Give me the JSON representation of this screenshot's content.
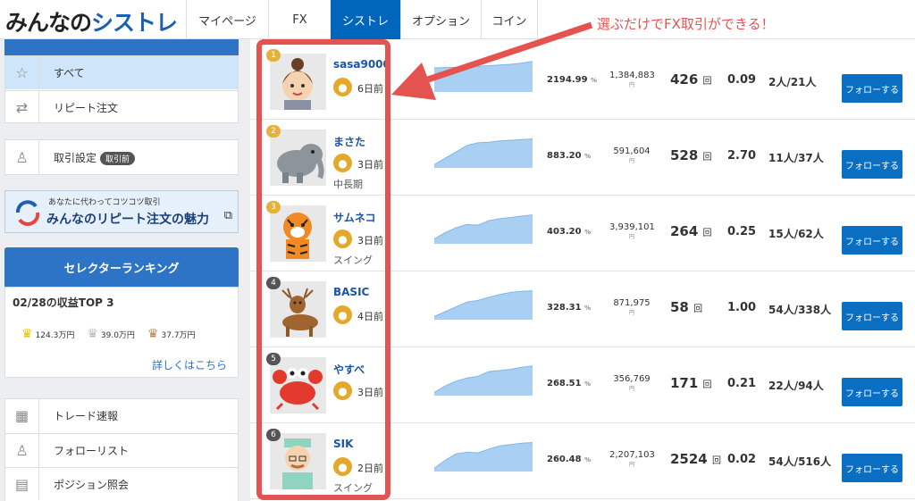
{
  "logo": {
    "part1": "みんなの",
    "part2": "シストレ"
  },
  "nav": {
    "tabs": [
      "マイページ",
      "FX",
      "シストレ",
      "オプション",
      "コイン"
    ]
  },
  "sidebar": {
    "menu1": [
      {
        "icon": "star-icon",
        "label": "すべて"
      },
      {
        "icon": "repeat-icon",
        "label": "リピート注文"
      }
    ],
    "settings": {
      "label": "取引設定",
      "badge": "取引前"
    },
    "banner": {
      "line1": "あなたに代わってコツコツ取引",
      "line2": "みんなのリピート注文の魅力"
    },
    "ranking": {
      "header": "セレクターランキング",
      "subtitle": "02/28の収益TOP 3",
      "crowns": [
        {
          "color": "#e8c100",
          "amount": "124.3万円"
        },
        {
          "color": "#b9b9b9",
          "amount": "39.0万円"
        },
        {
          "color": "#b7874a",
          "amount": "37.7万円"
        }
      ],
      "more": "詳しくはこちら"
    },
    "menu2": [
      {
        "icon": "grid-icon",
        "label": "トレード速報"
      },
      {
        "icon": "person-icon",
        "label": "フォローリスト"
      },
      {
        "icon": "book-icon",
        "label": "ポジション照会"
      }
    ]
  },
  "rows": [
    {
      "rank": "1",
      "rank_color": "#e3b23c",
      "name": "sasa9000",
      "days": "6日前",
      "style": "",
      "trend": [
        0.75,
        0.76,
        0.77,
        0.78,
        0.8,
        0.82,
        0.84,
        0.86,
        0.9,
        0.95
      ],
      "pct": "2194.99",
      "pct_unit": "%",
      "amount": "1,384,883",
      "amount_unit": "円",
      "count": "426",
      "count_unit": "回",
      "ratio": "0.09",
      "followers": "2人/21人",
      "avatar": "woman"
    },
    {
      "rank": "2",
      "rank_color": "#e3b23c",
      "name": "まさた",
      "days": "3日前",
      "style": "中長期",
      "trend": [
        0.1,
        0.3,
        0.5,
        0.7,
        0.78,
        0.8,
        0.84,
        0.86,
        0.88,
        0.9
      ],
      "pct": "883.20",
      "pct_unit": "%",
      "amount": "591,604",
      "amount_unit": "円",
      "count": "528",
      "count_unit": "回",
      "ratio": "2.70",
      "followers": "11人/37人",
      "avatar": "elephant"
    },
    {
      "rank": "3",
      "rank_color": "#e3b23c",
      "name": "サムネコ",
      "days": "3日前",
      "style": "スイング",
      "trend": [
        0.15,
        0.35,
        0.5,
        0.6,
        0.58,
        0.72,
        0.78,
        0.82,
        0.86,
        0.9
      ],
      "pct": "403.20",
      "pct_unit": "%",
      "amount": "3,939,101",
      "amount_unit": "円",
      "count": "264",
      "count_unit": "回",
      "ratio": "0.25",
      "followers": "15人/62人",
      "avatar": "tiger"
    },
    {
      "rank": "4",
      "rank_color": "#555555",
      "name": "BASIC",
      "days": "4日前",
      "style": "",
      "trend": [
        0.1,
        0.25,
        0.4,
        0.55,
        0.6,
        0.7,
        0.78,
        0.85,
        0.88,
        0.9
      ],
      "pct": "328.31",
      "pct_unit": "%",
      "amount": "871,975",
      "amount_unit": "円",
      "count": "58",
      "count_unit": "回",
      "ratio": "1.00",
      "followers": "54人/338人",
      "avatar": "deer"
    },
    {
      "rank": "5",
      "rank_color": "#555555",
      "name": "やすべ",
      "days": "3日前",
      "style": "",
      "trend": [
        0.1,
        0.3,
        0.45,
        0.55,
        0.6,
        0.75,
        0.78,
        0.82,
        0.88,
        0.92
      ],
      "pct": "268.51",
      "pct_unit": "%",
      "amount": "356,769",
      "amount_unit": "円",
      "count": "171",
      "count_unit": "回",
      "ratio": "0.21",
      "followers": "22人/94人",
      "avatar": "crab"
    },
    {
      "rank": "6",
      "rank_color": "#555555",
      "name": "SIK",
      "days": "2日前",
      "style": "スイング",
      "trend": [
        0.1,
        0.35,
        0.55,
        0.6,
        0.58,
        0.7,
        0.8,
        0.84,
        0.88,
        0.9
      ],
      "pct": "260.48",
      "pct_unit": "%",
      "amount": "2,207,103",
      "amount_unit": "円",
      "count": "2524",
      "count_unit": "回",
      "ratio": "0.02",
      "followers": "54人/516人",
      "avatar": "doctor"
    }
  ],
  "follow_label": "フォローする",
  "annotation": "選ぶだけでFX取引ができる！"
}
